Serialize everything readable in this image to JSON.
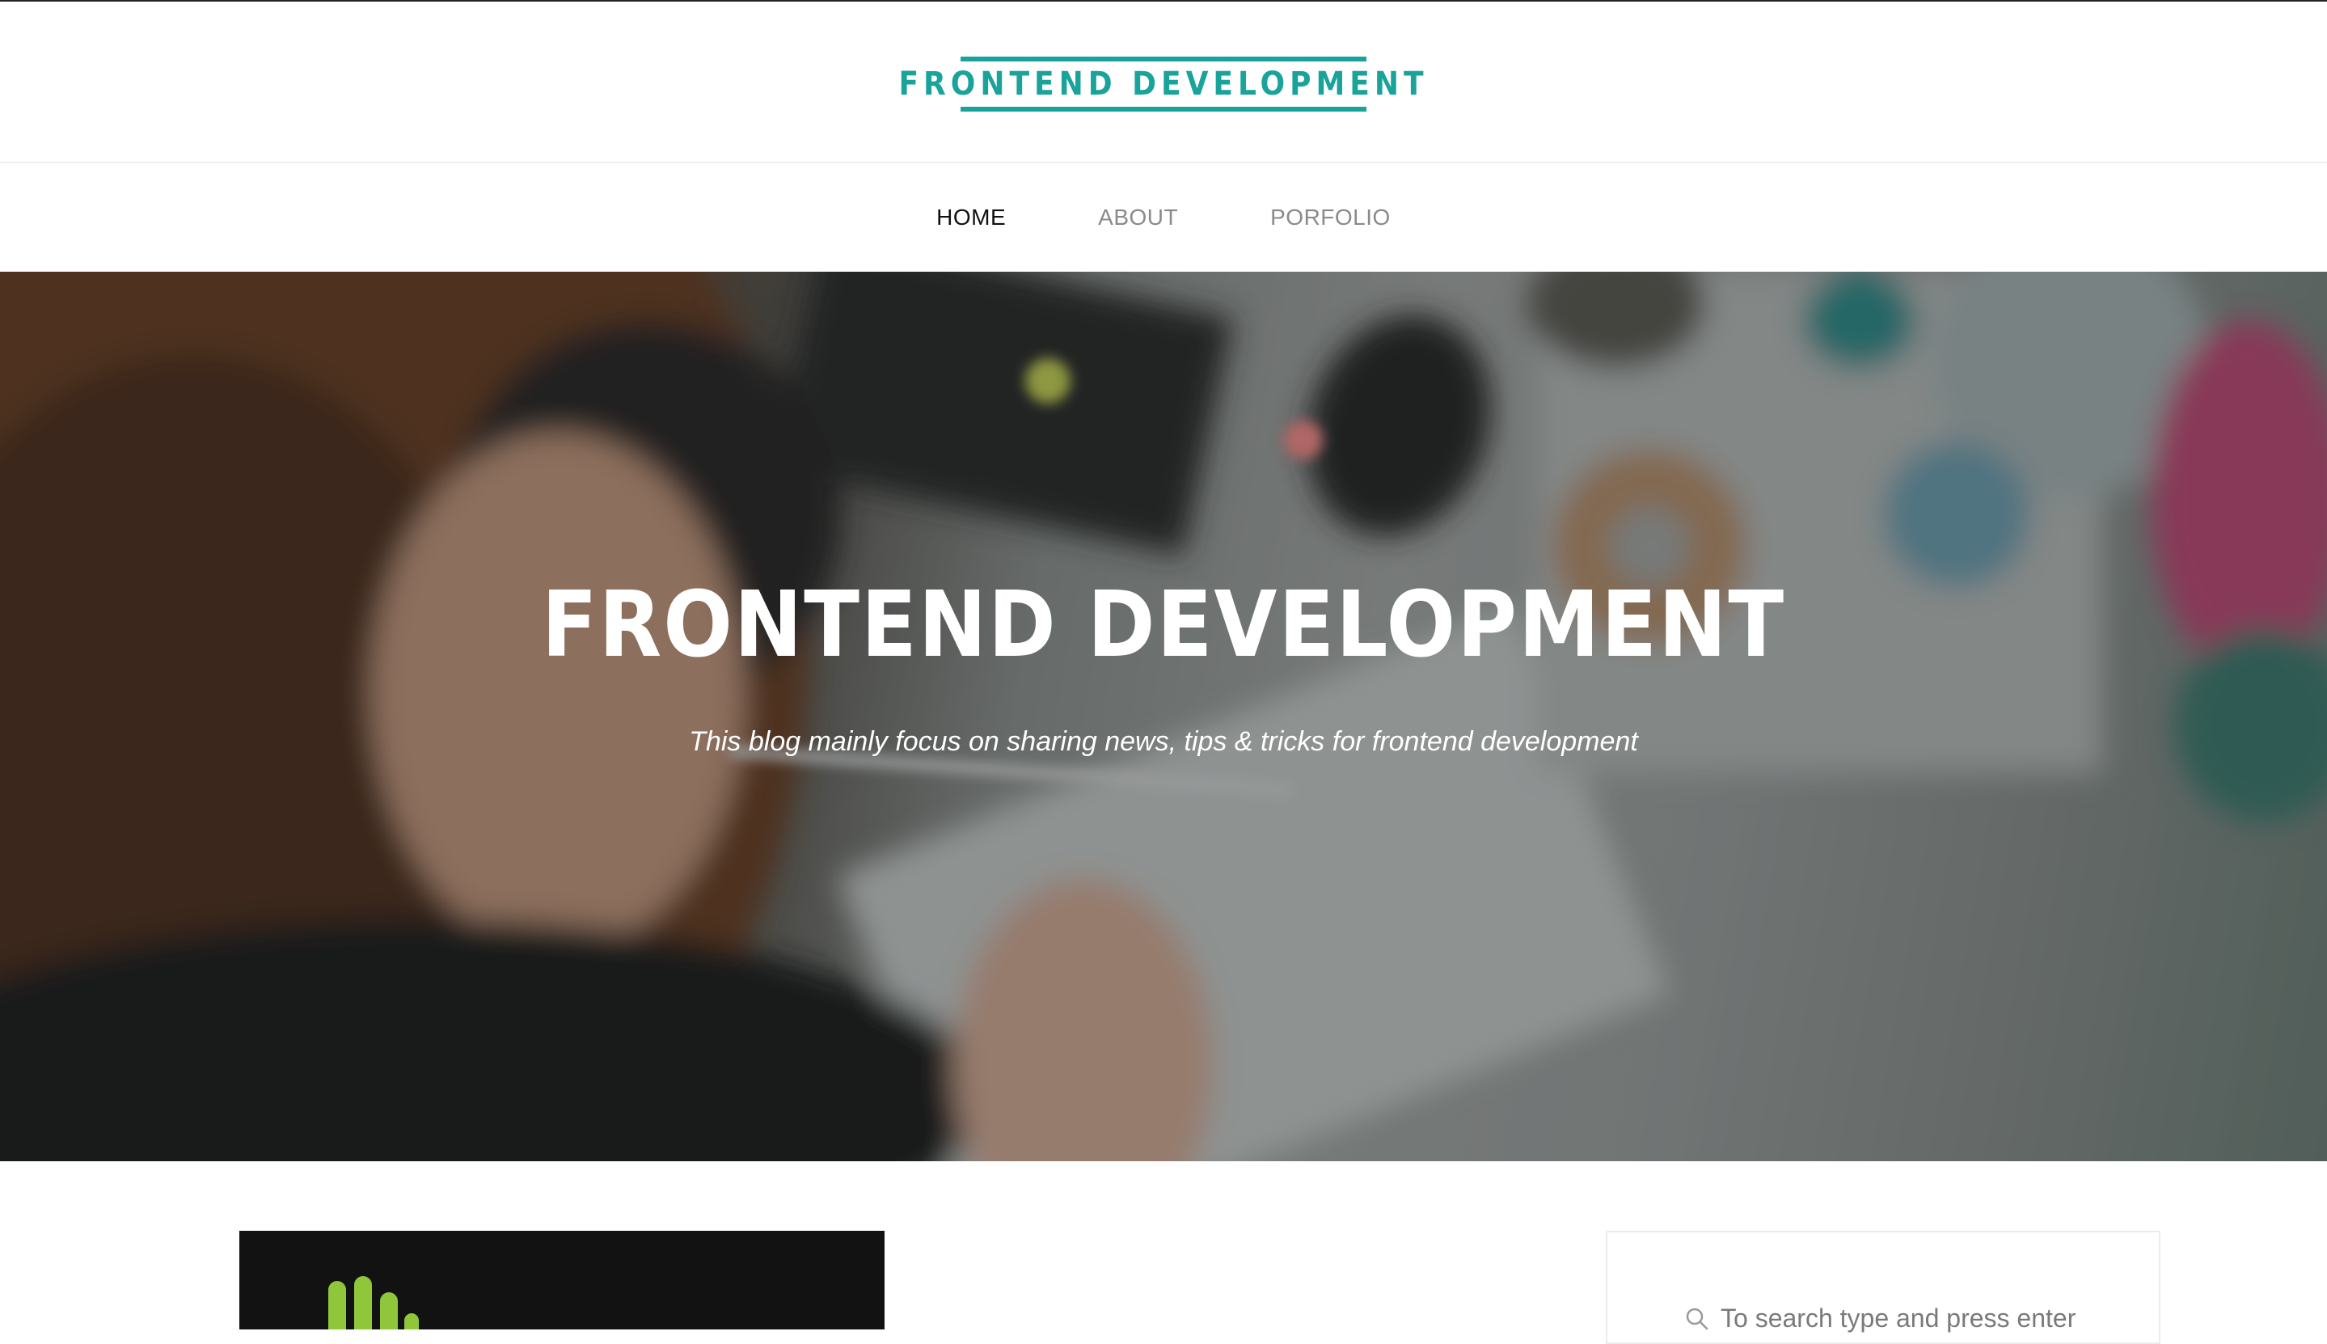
{
  "header": {
    "logo_text": "FRONTEND DEVELOPMENT",
    "accent_color": "#1aa39a"
  },
  "nav": {
    "items": [
      {
        "label": "HOME",
        "active": true
      },
      {
        "label": "ABOUT",
        "active": false
      },
      {
        "label": "PORFOLIO",
        "active": false
      }
    ]
  },
  "hero": {
    "title": "FRONTEND DEVELOPMENT",
    "subtitle": "This blog mainly focus on sharing news, tips & tricks for frontend development",
    "image": "woman-at-desk-photo"
  },
  "main": {
    "post_thumbnail": "post-thumbnail-image"
  },
  "sidebar": {
    "search": {
      "icon": "search-icon",
      "placeholder": "To search type and press enter"
    }
  }
}
